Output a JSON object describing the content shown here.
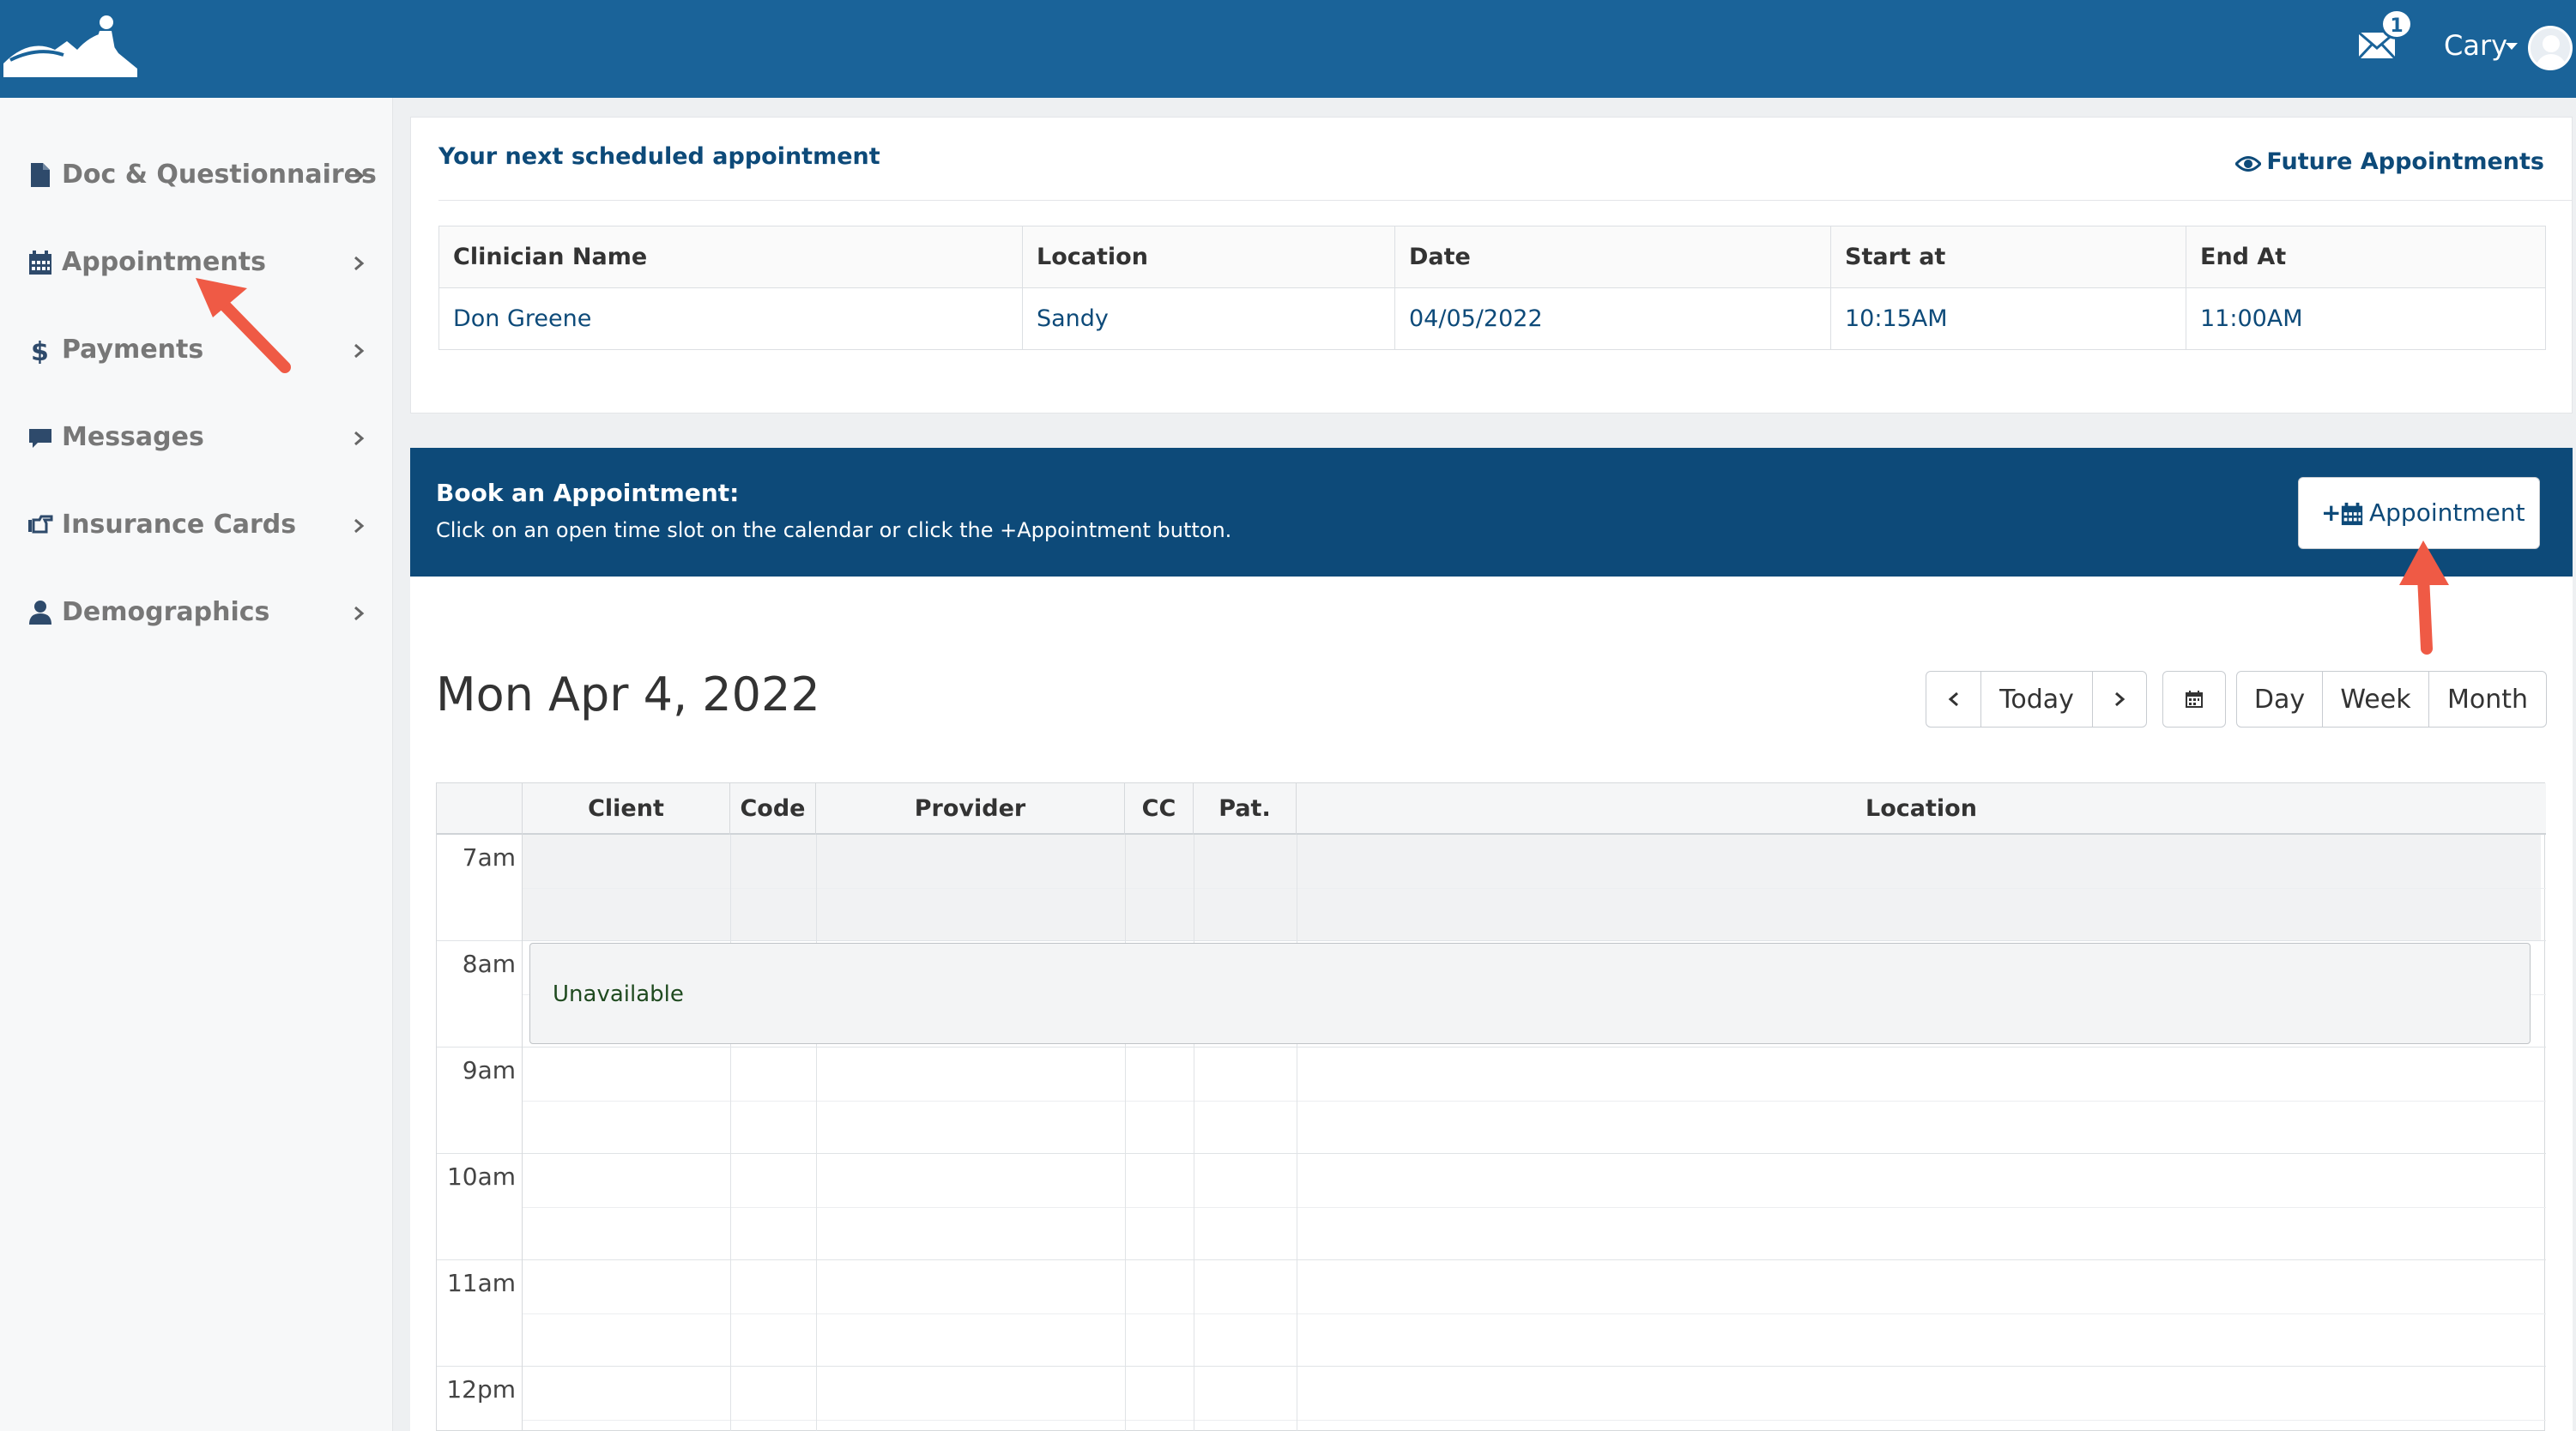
{
  "header": {
    "mail_badge": "1",
    "user_name": "Cary"
  },
  "sidebar": {
    "items": [
      {
        "label": "Doc & Questionnaires",
        "icon": "file-icon"
      },
      {
        "label": "Appointments",
        "icon": "calendar-icon"
      },
      {
        "label": "Payments",
        "icon": "dollar-icon"
      },
      {
        "label": "Messages",
        "icon": "comment-icon"
      },
      {
        "label": "Insurance Cards",
        "icon": "hand-pointer-icon"
      },
      {
        "label": "Demographics",
        "icon": "user-icon"
      }
    ]
  },
  "next_appointment": {
    "title": "Your next scheduled appointment",
    "future_link": "Future Appointments",
    "columns": [
      "Clinician Name",
      "Location",
      "Date",
      "Start at",
      "End At"
    ],
    "row": [
      "Don Greene",
      "Sandy",
      "04/05/2022",
      "10:15AM",
      "11:00AM"
    ]
  },
  "book": {
    "title": "Book an Appointment:",
    "subtitle": "Click on an open time slot on the calendar or click the +Appointment button.",
    "button_plus": "+",
    "button_label": "Appointment"
  },
  "calendar": {
    "date_title": "Mon Apr 4, 2022",
    "today_label": "Today",
    "views": [
      "Day",
      "Week",
      "Month"
    ],
    "columns": [
      "Client",
      "Code",
      "Provider",
      "CC",
      "Pat. Bal.",
      "Location"
    ],
    "hours": [
      "7am",
      "8am",
      "9am",
      "10am",
      "11am",
      "12pm"
    ],
    "unavailable_label": "Unavailable"
  },
  "colors": {
    "topbar": "#1a6399",
    "primary_dark": "#0d4a79",
    "annotation_arrow": "#ef5a45"
  }
}
